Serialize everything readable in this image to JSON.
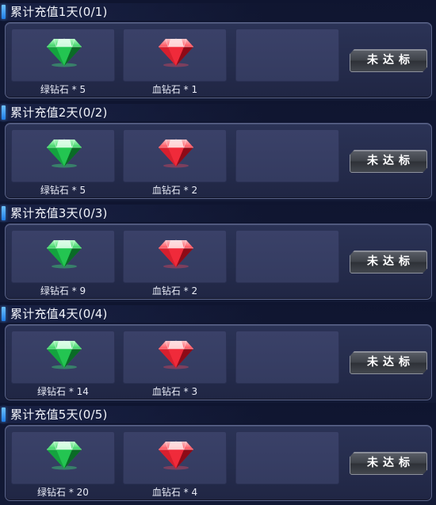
{
  "button_label": "未达标",
  "colors": {
    "header_accent": "#1f7de6",
    "green_gem": "#2fd35a",
    "red_gem": "#ff3b48"
  },
  "rows": [
    {
      "title": "累计充值1天(0/1)",
      "rewards": [
        {
          "icon": "green-diamond-icon",
          "label": "绿钻石 * 5"
        },
        {
          "icon": "red-diamond-icon",
          "label": "血钻石 * 1"
        }
      ]
    },
    {
      "title": "累计充值2天(0/2)",
      "rewards": [
        {
          "icon": "green-diamond-icon",
          "label": "绿钻石 * 5"
        },
        {
          "icon": "red-diamond-icon",
          "label": "血钻石 * 2"
        }
      ]
    },
    {
      "title": "累计充值3天(0/3)",
      "rewards": [
        {
          "icon": "green-diamond-icon",
          "label": "绿钻石 * 9"
        },
        {
          "icon": "red-diamond-icon",
          "label": "血钻石 * 2"
        }
      ]
    },
    {
      "title": "累计充值4天(0/4)",
      "rewards": [
        {
          "icon": "green-diamond-icon",
          "label": "绿钻石 * 14"
        },
        {
          "icon": "red-diamond-icon",
          "label": "血钻石 * 3"
        }
      ]
    },
    {
      "title": "累计充值5天(0/5)",
      "rewards": [
        {
          "icon": "green-diamond-icon",
          "label": "绿钻石 * 20"
        },
        {
          "icon": "red-diamond-icon",
          "label": "血钻石 * 4"
        }
      ]
    }
  ]
}
